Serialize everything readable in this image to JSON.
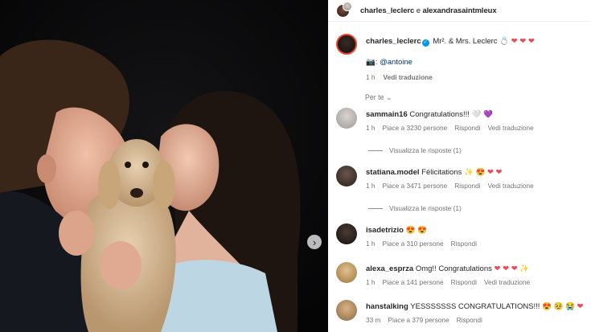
{
  "header": {
    "user1": "charles_leclerc",
    "conj": "e",
    "user2": "alexandrasaintmleux"
  },
  "caption": {
    "username": "charles_leclerc",
    "text": "Mr². & Mrs. Leclerc",
    "emoji": "💍 ❤ ❤ ❤",
    "camera": "📷:",
    "mention": "@antoine",
    "time": "1 h",
    "translate": "Vedi traduzione"
  },
  "filter": {
    "label": "Per te"
  },
  "comments": [
    {
      "username": "sammain16",
      "text": "Congratulations!!!",
      "emoji": "🤍 💜",
      "time": "1 h",
      "likes": "Piace a 3230 persone",
      "reply": "Rispondi",
      "translate": "Vedi traduzione",
      "av_color": "#c8c3be"
    },
    {
      "username": "statiana.model",
      "text": "Félicitations",
      "emoji": "✨ 😍 ❤ ❤",
      "time": "1 h",
      "likes": "Piace a 3471 persone",
      "reply": "Rispondi",
      "translate": "Vedi traduzione",
      "av_color": "#4a3b35"
    },
    {
      "username": "isadetrizio",
      "text": "",
      "emoji": "😍 😍",
      "time": "1 h",
      "likes": "Piace a 310 persone",
      "reply": "Rispondi",
      "translate": "",
      "av_color": "#2a2320"
    },
    {
      "username": "alexa_esprza",
      "text": "Omg!! Congratulations",
      "emoji": "❤ ❤ ❤ ✨",
      "time": "1 h",
      "likes": "Piace a 141 persone",
      "reply": "Rispondi",
      "translate": "Vedi traduzione",
      "av_color": "#c9a36a"
    },
    {
      "username": "hanstalking",
      "text": "YESSSSSSS CONGRATULATIONS!!!",
      "emoji": "😍 🥹 😭 ❤",
      "time": "33 m",
      "likes": "Piace a 379 persone",
      "reply": "Rispondi",
      "translate": "",
      "av_color": "#b58e62"
    }
  ],
  "replies": [
    {
      "label": "Visualizza le risposte (1)"
    },
    {
      "label": "Visualizza le risposte (1)"
    }
  ],
  "photo": {
    "next_icon": "›"
  }
}
